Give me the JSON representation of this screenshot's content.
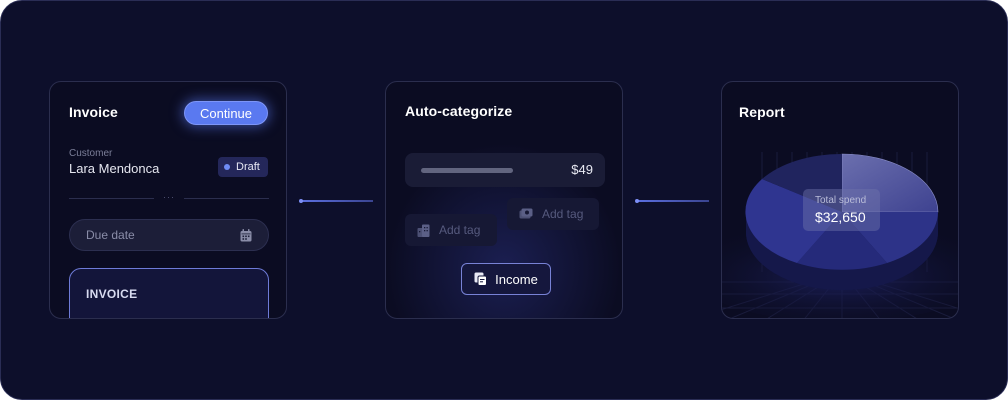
{
  "invoice": {
    "title": "Invoice",
    "continue_label": "Continue",
    "customer_label": "Customer",
    "customer_name": "Lara Mendonca",
    "status": "Draft",
    "divider_dots": "···",
    "due_date_placeholder": "Due date",
    "panel_label": "INVOICE"
  },
  "autocategorize": {
    "title": "Auto-categorize",
    "amount": "$49",
    "tags": [
      "Add tag",
      "Add tag"
    ],
    "category": "Income"
  },
  "report": {
    "title": "Report",
    "total_label": "Total spend",
    "total_value": "$32,650"
  },
  "colors": {
    "background": "#0d0f2b",
    "accent": "#5a79f0",
    "card": "#0b0c22"
  },
  "icons": [
    "calendar-icon",
    "building-icon",
    "money-icon",
    "receipt-icon"
  ]
}
